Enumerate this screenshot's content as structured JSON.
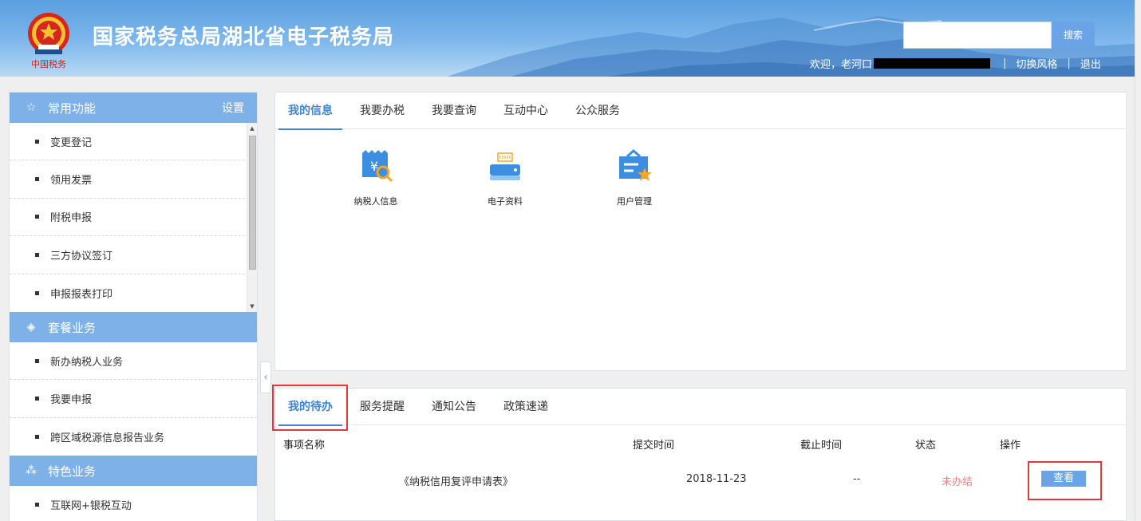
{
  "header": {
    "title": "国家税务总局湖北省电子税务局",
    "search_button": "搜索",
    "search_placeholder": "",
    "welcome": "欢迎，老河口",
    "switch_style": "切换风格",
    "logout": "退出",
    "signature": "中国税务"
  },
  "sidebar": {
    "common": {
      "title": "常用功能",
      "setting": "设置",
      "items": [
        "变更登记",
        "领用发票",
        "附税申报",
        "三方协议签订",
        "申报报表打印"
      ]
    },
    "package": {
      "title": "套餐业务",
      "items": [
        "新办纳税人业务",
        "我要申报",
        "跨区域税源信息报告业务"
      ]
    },
    "special": {
      "title": "特色业务",
      "items": [
        "互联网+银税互动"
      ]
    }
  },
  "top_panel": {
    "tabs": [
      "我的信息",
      "我要办税",
      "我要查询",
      "互动中心",
      "公众服务"
    ],
    "tiles": [
      "纳税人信息",
      "电子资料",
      "用户管理"
    ]
  },
  "bottom_panel": {
    "tabs": [
      "我的待办",
      "服务提醒",
      "通知公告",
      "政策速递"
    ],
    "columns": [
      "事项名称",
      "提交时间",
      "截止时间",
      "状态",
      "操作"
    ],
    "rows": [
      {
        "name": "《纳税信用复评申请表》",
        "submit_time": "2018-11-23",
        "deadline": "--",
        "status": "未办结",
        "action": "查看"
      }
    ]
  },
  "colors": {
    "accent": "#3f86d8",
    "section": "#7fb1e9",
    "button": "#6aa4e6",
    "highlight": "#e0393e",
    "status_pending": "#e8848a"
  }
}
